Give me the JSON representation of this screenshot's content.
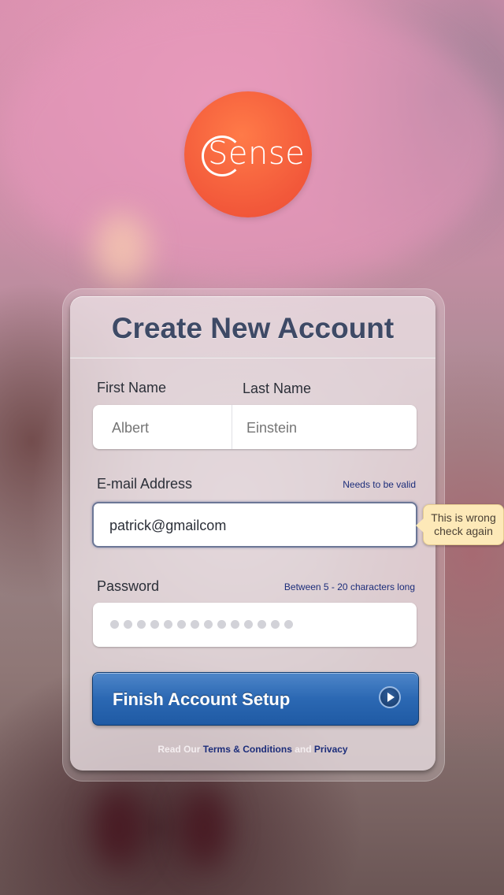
{
  "logo": {
    "text": "Sense",
    "color": "#f2583a"
  },
  "form": {
    "title": "Create New Account",
    "first_name": {
      "label": "First Name",
      "placeholder": "Albert"
    },
    "last_name": {
      "label": "Last Name",
      "placeholder": "Einstein"
    },
    "email": {
      "label": "E-mail Address",
      "hint": "Needs to be valid",
      "value": "patrick@gmailcom",
      "error_tooltip_line1": "This is wrong",
      "error_tooltip_line2": "check again"
    },
    "password": {
      "label": "Password",
      "hint": "Between 5 - 20 characters long",
      "masked_length": 14
    },
    "submit": {
      "label": "Finish Account Setup",
      "icon": "play-icon",
      "color": "#2b68b3"
    },
    "footer": {
      "prefix": "Read Our",
      "terms": "Terms & Conditions",
      "and": "and",
      "privacy": "Privacy"
    }
  }
}
